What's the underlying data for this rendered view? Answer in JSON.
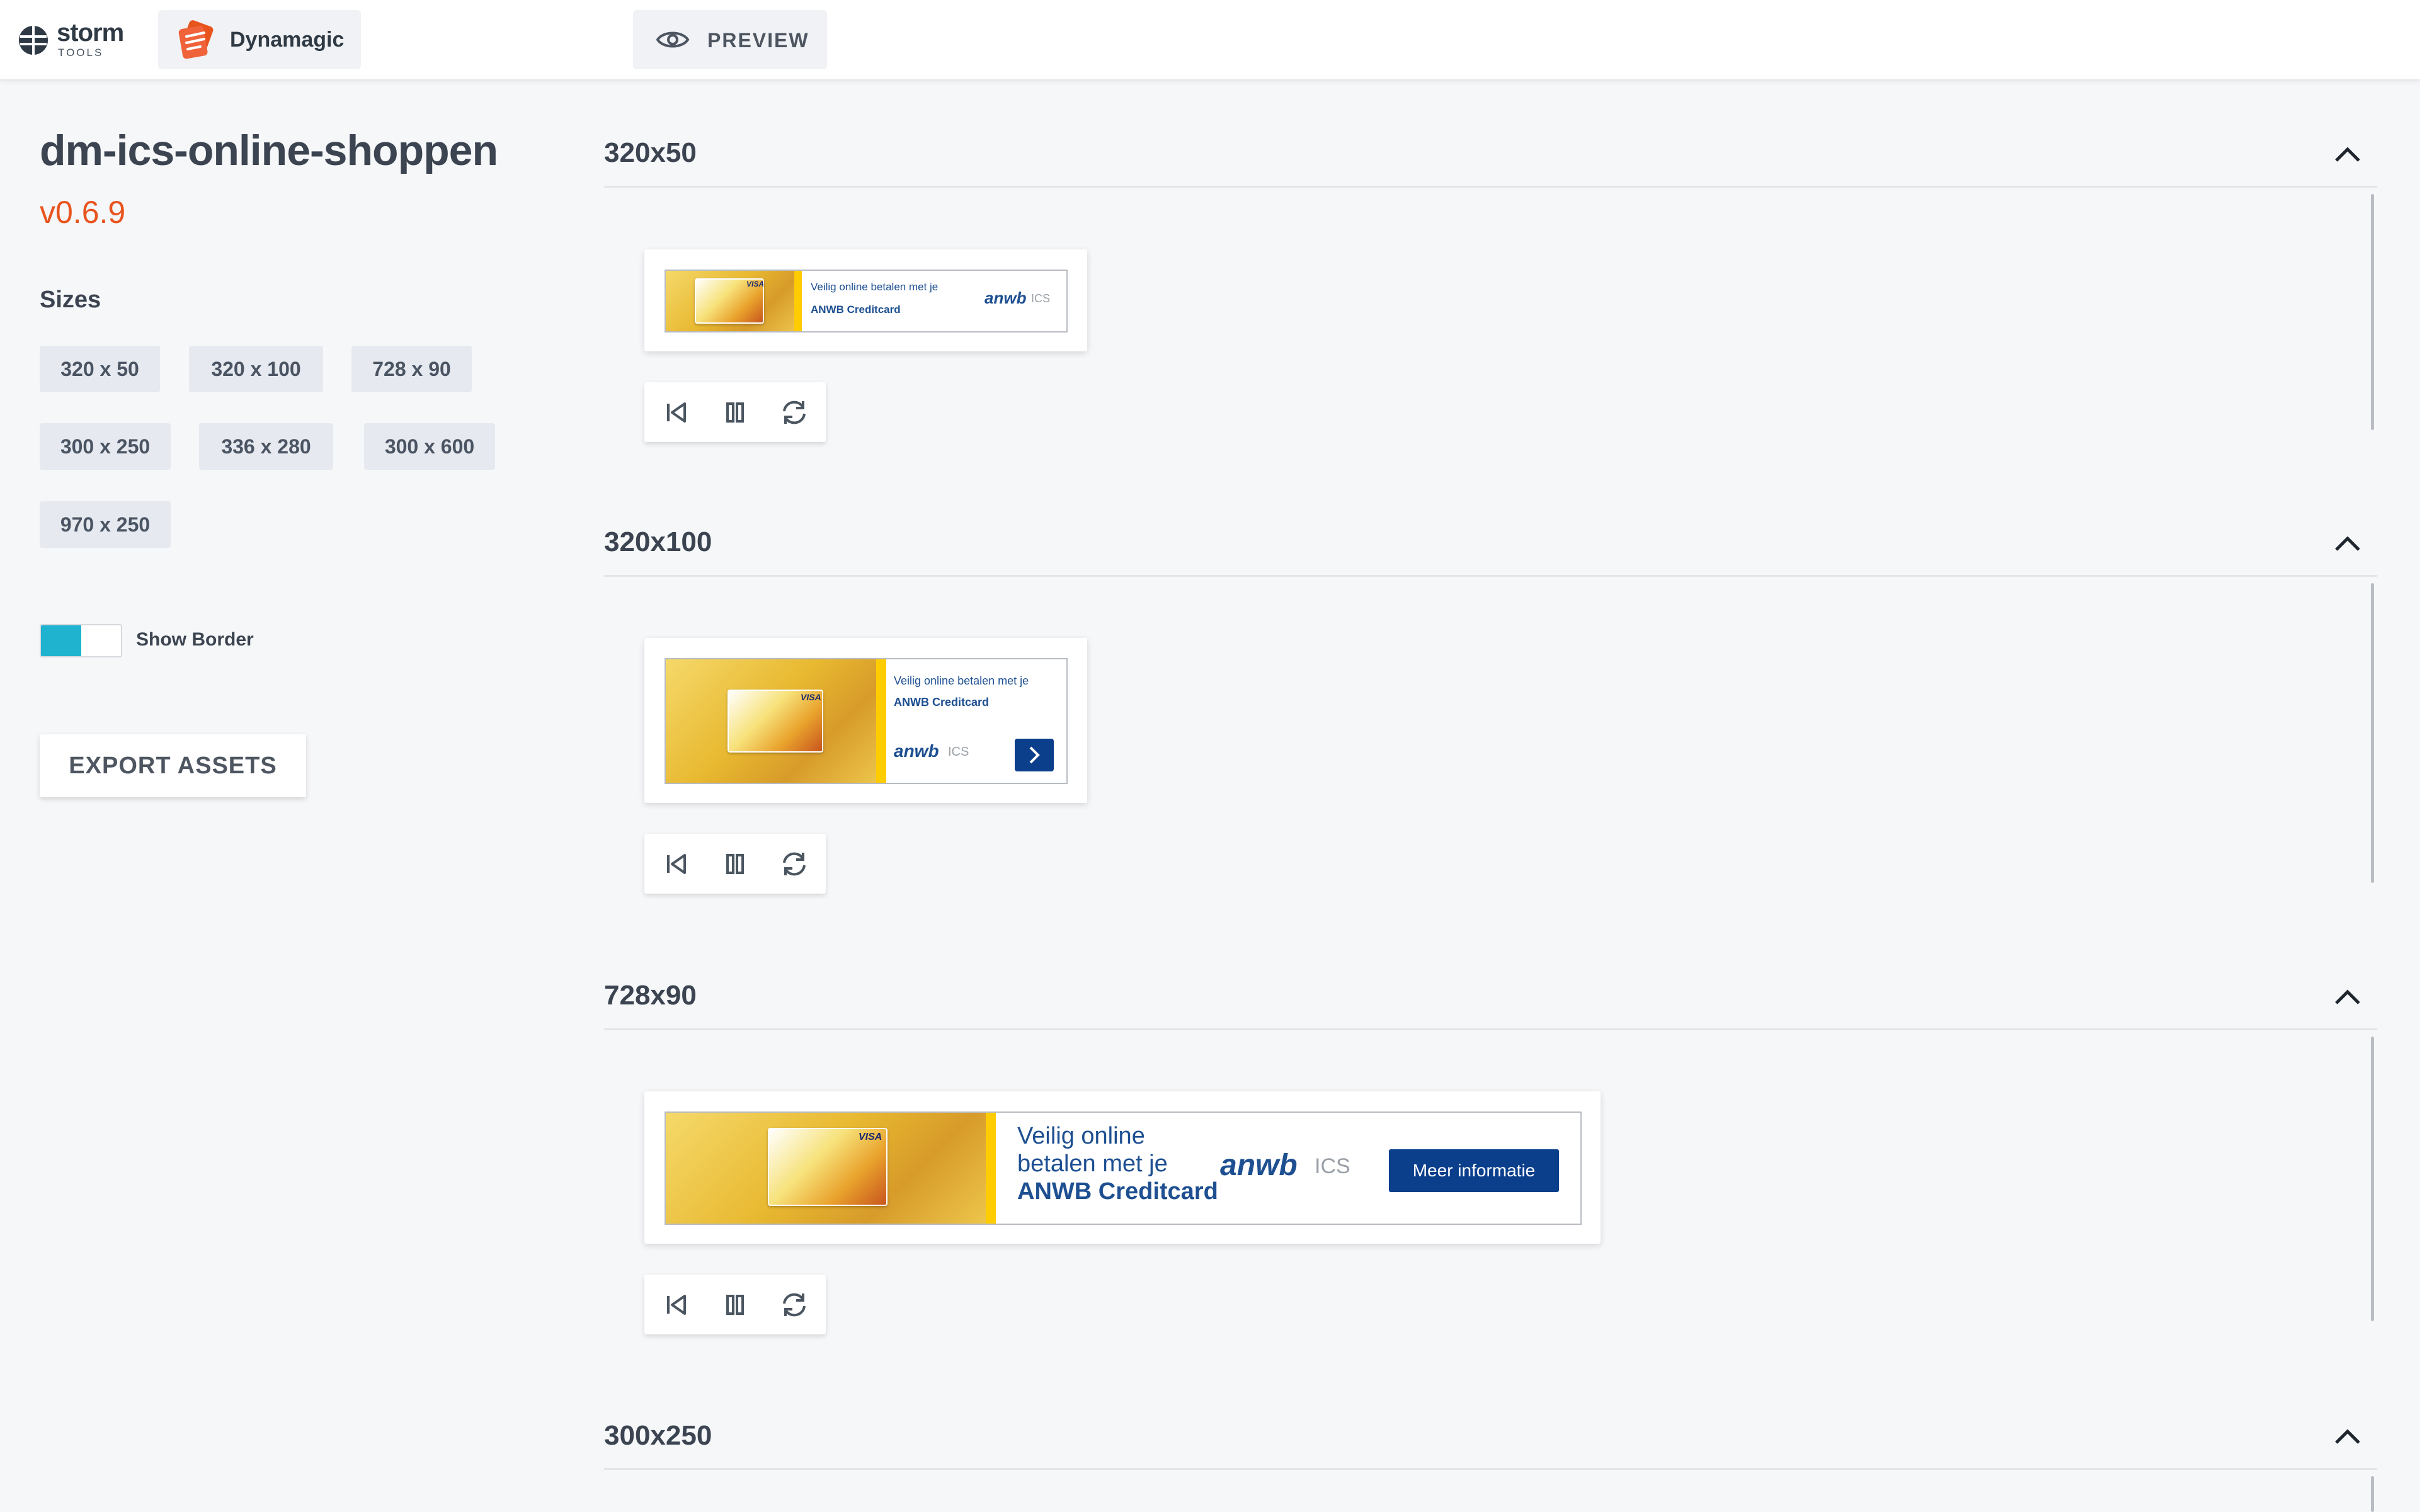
{
  "header": {
    "logo_word": "storm",
    "logo_sub": "TOOLS",
    "app_name": "Dynamagic",
    "preview_label": "PREVIEW"
  },
  "sidebar": {
    "project_title": "dm-ics-online-shoppen",
    "version": "v0.6.9",
    "sizes_label": "Sizes",
    "sizes": [
      "320 x 50",
      "320 x 100",
      "728 x 90",
      "300 x 250",
      "336 x 280",
      "300 x 600",
      "970 x 250"
    ],
    "show_border_label": "Show Border",
    "show_border_on": true,
    "export_label": "EXPORT ASSETS"
  },
  "colors": {
    "accent": "#e8541e",
    "toggle": "#1fb3cf",
    "anwb_blue": "#1d4f91",
    "cta_blue": "#0b3f8c",
    "banner_yellow": "#ffcc00"
  },
  "sections": [
    {
      "title": "320x50",
      "banner": {
        "line1": "Veilig online betalen met je",
        "line2": "ANWB Creditcard",
        "brand": "anwb",
        "issuer": "ICS",
        "card_mark": "VISA"
      }
    },
    {
      "title": "320x100",
      "banner": {
        "line1": "Veilig online betalen met je",
        "line2": "ANWB Creditcard",
        "brand": "anwb",
        "issuer": "ICS",
        "card_mark": "VISA"
      }
    },
    {
      "title": "728x90",
      "banner": {
        "line1a": "Veilig online",
        "line1b": "betalen met je",
        "line2": "ANWB Creditcard",
        "brand": "anwb",
        "issuer": "ICS",
        "cta": "Meer informatie",
        "card_mark": "VISA"
      }
    },
    {
      "title": "300x250"
    }
  ],
  "controls": {
    "icons": [
      "skip-back-icon",
      "pause-icon",
      "replay-icon"
    ]
  }
}
